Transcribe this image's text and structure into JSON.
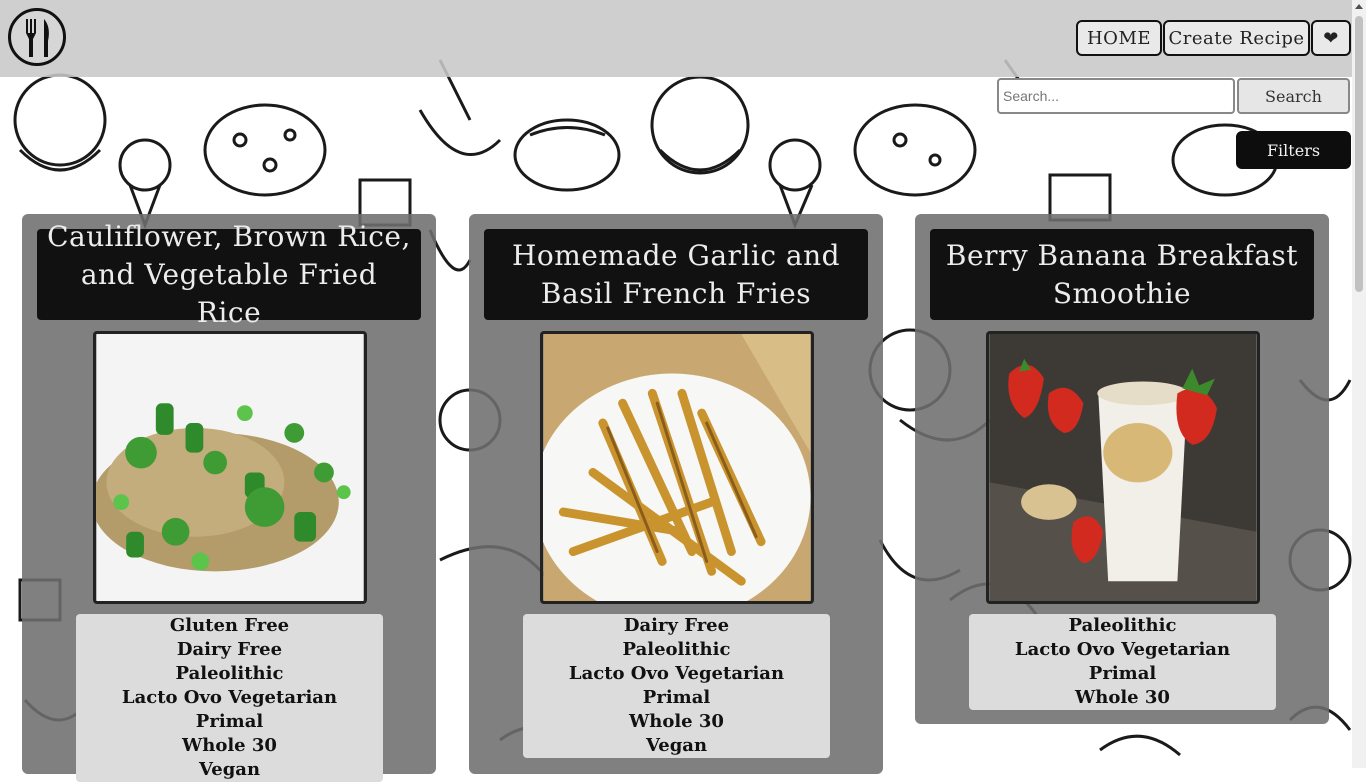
{
  "header": {
    "logo_icon": "fork-knife-icon",
    "nav": {
      "home_label": "HOME",
      "create_label": "Create Recipe",
      "favorites_label": "❤"
    }
  },
  "search": {
    "placeholder": "Search...",
    "button_label": "Search",
    "filters_label": "Filters"
  },
  "recipes": [
    {
      "title": "Cauliflower, Brown Rice, and Vegetable Fried Rice",
      "image_icon": "fried-rice-photo",
      "diets": [
        "Gluten Free",
        "Dairy Free",
        "Paleolithic",
        "Lacto Ovo Vegetarian",
        "Primal",
        "Whole 30",
        "Vegan"
      ]
    },
    {
      "title": "Homemade Garlic and Basil French Fries",
      "image_icon": "french-fries-photo",
      "diets": [
        "Dairy Free",
        "Paleolithic",
        "Lacto Ovo Vegetarian",
        "Primal",
        "Whole 30",
        "Vegan"
      ]
    },
    {
      "title": "Berry Banana Breakfast Smoothie",
      "image_icon": "smoothie-photo",
      "diets": [
        "Paleolithic",
        "Lacto Ovo Vegetarian",
        "Primal",
        "Whole 30"
      ]
    }
  ]
}
